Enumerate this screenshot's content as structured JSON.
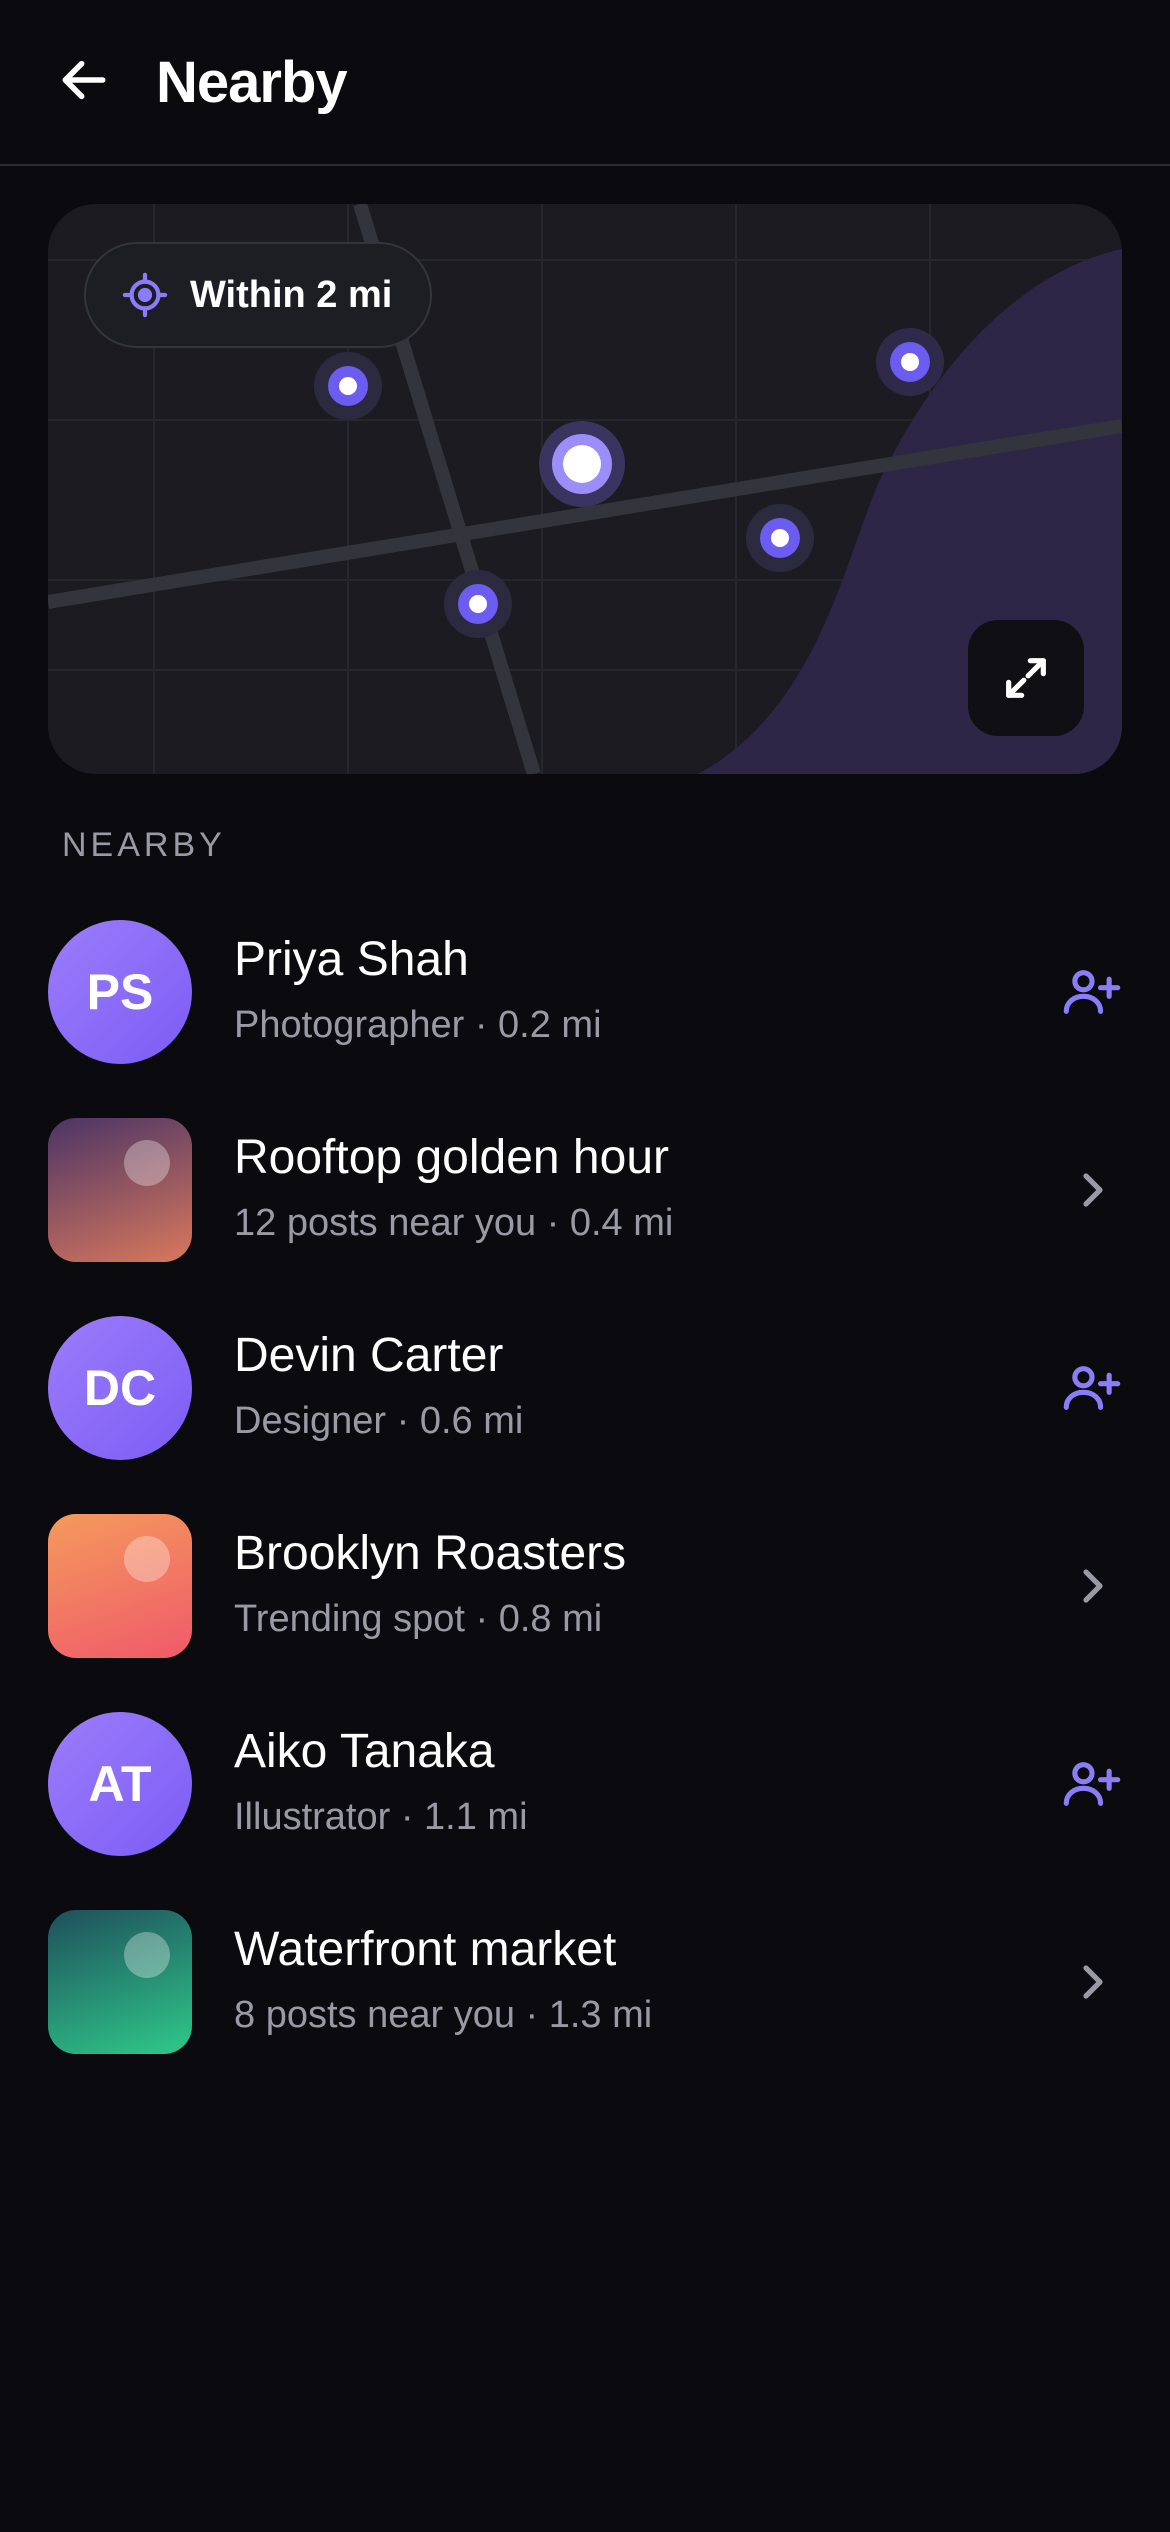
{
  "header": {
    "title": "Nearby",
    "back_icon": "arrow-left-icon"
  },
  "map": {
    "radius_label": "Within 2 mi",
    "radius_icon": "locate-icon",
    "expand_icon": "expand-icon",
    "accent_color": "#7c6cf6",
    "area_color": "#2d2647"
  },
  "section": {
    "label": "NEARBY"
  },
  "items": [
    {
      "type": "person",
      "initials": "PS",
      "title": "Priya Shah",
      "subtitle": "Photographer · 0.2 mi",
      "action_icon": "add-friend-icon"
    },
    {
      "type": "place",
      "title": "Rooftop golden hour",
      "subtitle": "12 posts near you · 0.4 mi",
      "action_icon": "chevron-right-icon",
      "gradient": [
        "#4b3466",
        "#d9785c"
      ]
    },
    {
      "type": "person",
      "initials": "DC",
      "title": "Devin Carter",
      "subtitle": "Designer · 0.6 mi",
      "action_icon": "add-friend-icon"
    },
    {
      "type": "place",
      "title": "Brooklyn Roasters",
      "subtitle": "Trending spot · 0.8 mi",
      "action_icon": "chevron-right-icon",
      "gradient": [
        "#f59a5c",
        "#ef5a6a"
      ]
    },
    {
      "type": "person",
      "initials": "AT",
      "title": "Aiko Tanaka",
      "subtitle": "Illustrator · 1.1 mi",
      "action_icon": "add-friend-icon"
    },
    {
      "type": "place",
      "title": "Waterfront market",
      "subtitle": "8 posts near you · 1.3 mi",
      "action_icon": "chevron-right-icon",
      "gradient": [
        "#1f4f5c",
        "#2fc98a"
      ]
    }
  ],
  "colors": {
    "background": "#0b0b0f",
    "accent": "#8b7cf8",
    "muted_text": "#9a9aa6",
    "avatar_gradient": [
      "#9b7dfa",
      "#7c5cf5"
    ]
  }
}
